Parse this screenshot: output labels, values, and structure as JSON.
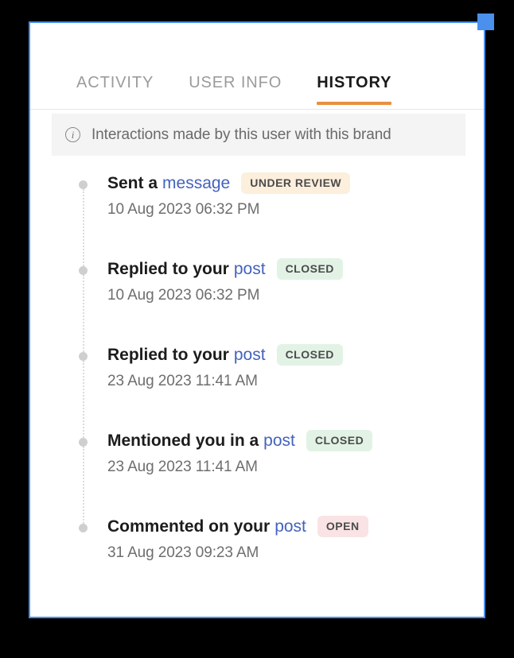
{
  "panel": {
    "resize_handle": "resize-handle",
    "accent_border": "#4a90ec"
  },
  "tabs": [
    {
      "label": "ACTIVITY",
      "active": false
    },
    {
      "label": "USER INFO",
      "active": false
    },
    {
      "label": "HISTORY",
      "active": true
    }
  ],
  "info_banner": {
    "icon": "info-circle-icon",
    "text": "Interactions made by this user with this brand"
  },
  "timeline": [
    {
      "action": "Sent a",
      "link": "message",
      "status": "UNDER REVIEW",
      "status_style": "under-review",
      "status_color": "#fcefdc",
      "date": "10 Aug 2023 06:32 PM"
    },
    {
      "action": "Replied to your",
      "link": "post",
      "status": "CLOSED",
      "status_style": "closed",
      "status_color": "#e2f3e5",
      "date": "10 Aug 2023 06:32 PM"
    },
    {
      "action": "Replied to your",
      "link": "post",
      "status": "CLOSED",
      "status_style": "closed",
      "status_color": "#e2f3e5",
      "date": "23 Aug 2023 11:41 AM"
    },
    {
      "action": "Mentioned you in a",
      "link": "post",
      "status": "CLOSED",
      "status_style": "closed",
      "status_color": "#e2f3e5",
      "date": "23 Aug 2023 11:41 AM"
    },
    {
      "action": "Commented on your",
      "link": "post",
      "status": "OPEN",
      "status_style": "open",
      "status_color": "#fae3e4",
      "date": "31 Aug 2023 09:23 AM"
    }
  ],
  "colors": {
    "tab_active_underline": "#e8903f",
    "link": "#4462bd",
    "timeline_dot": "#cfcfcf",
    "banner_bg": "#f4f4f4"
  }
}
